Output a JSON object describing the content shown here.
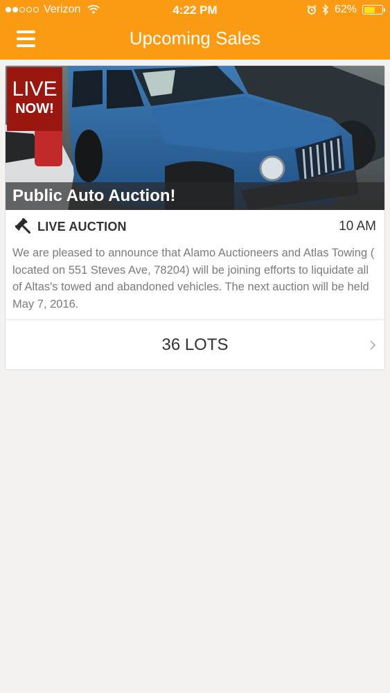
{
  "status_bar": {
    "carrier": "Verizon",
    "time": "4:22 PM",
    "battery_percent": "62%",
    "battery_level": 0.62,
    "icons": [
      "signal-dots-icon",
      "wifi-icon",
      "alarm-icon",
      "bluetooth-icon",
      "battery-icon"
    ]
  },
  "header": {
    "title": "Upcoming Sales",
    "menu_icon": "hamburger-menu-icon"
  },
  "sale": {
    "badge_line1": "LIVE",
    "badge_line2": "NOW!",
    "title": "Public Auto Auction!",
    "type_icon": "gavel-icon",
    "type": "LIVE AUCTION",
    "time": "10 AM",
    "description": "We are pleased to announce that Alamo Auctioneers and Atlas Towing ( located on 551 Steves Ave, 78204) will be joining efforts to liquidate all of Altas's towed and abandoned vehicles. The next auction will be held May 7, 2016.",
    "lots_label": "36 LOTS",
    "lots_icon": "chevron-right-icon",
    "colors": {
      "accent": "#fb9b13",
      "badge": "#9a1710"
    }
  }
}
